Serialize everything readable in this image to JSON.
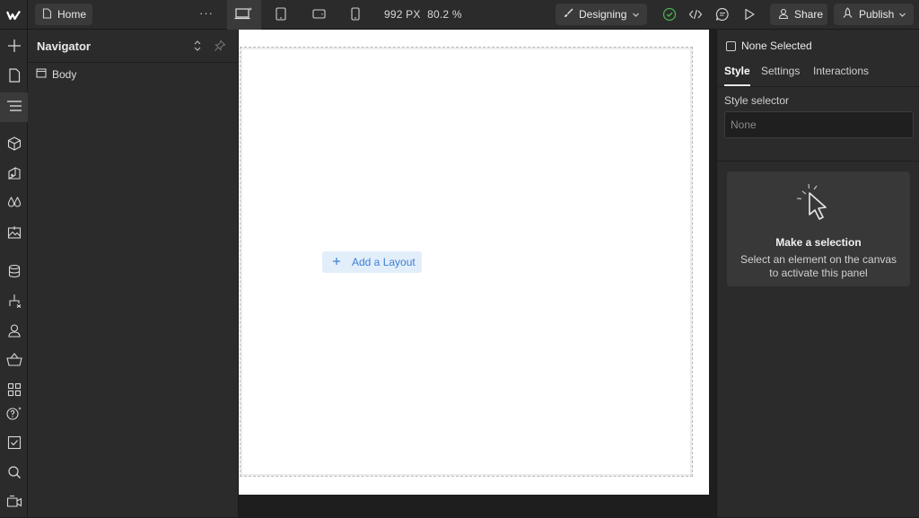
{
  "topbar": {
    "logo": "webflow-logo",
    "page_label": "Home",
    "more_label": "···",
    "size_label": "992 PX",
    "zoom_label": "80.2 %",
    "mode_label": "Designing",
    "share_label": "Share",
    "publish_label": "Publish"
  },
  "navigator": {
    "title": "Navigator",
    "tree": [
      {
        "label": "Body"
      }
    ]
  },
  "canvas": {
    "add_layout_label": "Add a Layout"
  },
  "right_panel": {
    "selection_label": "None Selected",
    "tabs": [
      {
        "label": "Style",
        "active": true
      },
      {
        "label": "Settings",
        "active": false
      },
      {
        "label": "Interactions",
        "active": false
      }
    ],
    "style_selector_label": "Style selector",
    "style_selector_placeholder": "None",
    "empty_title": "Make a selection",
    "empty_desc": "Select an element on the canvas to activate this panel"
  },
  "colors": {
    "panel_bg": "#2b2b2b",
    "canvas_bg": "#1e1e1e",
    "accent_blue": "#3b7fd6",
    "check_green": "#4caf50"
  }
}
